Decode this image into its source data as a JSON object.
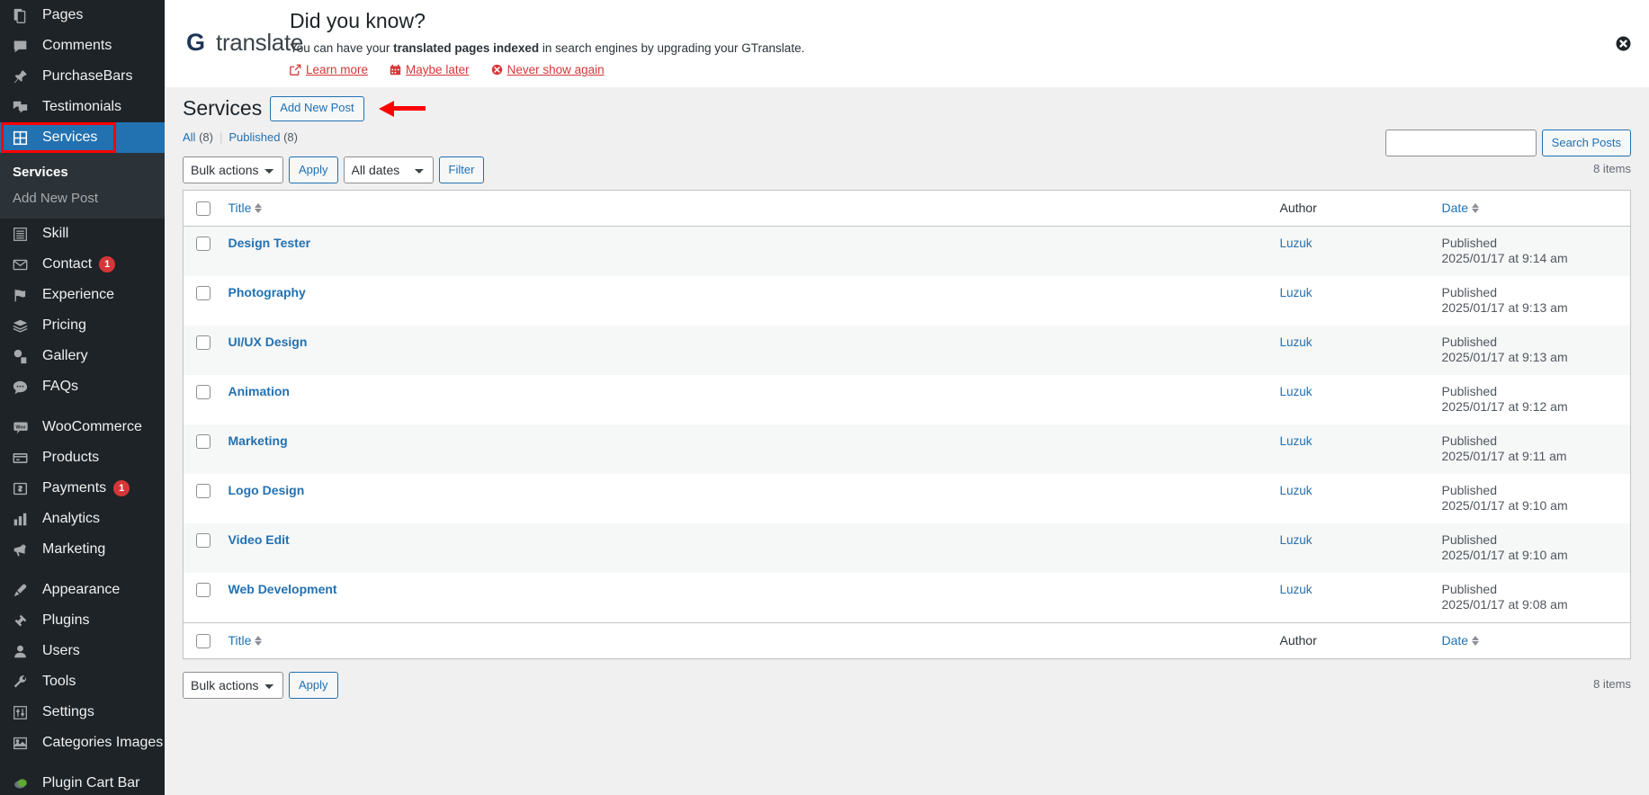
{
  "sidebar": {
    "items": [
      {
        "label": "Pages",
        "icon": "pages-icon",
        "badge": null,
        "current": false
      },
      {
        "label": "Comments",
        "icon": "comments-icon",
        "badge": null,
        "current": false
      },
      {
        "label": "PurchaseBars",
        "icon": "pin-icon",
        "badge": null,
        "current": false
      },
      {
        "label": "Testimonials",
        "icon": "testimonials-icon",
        "badge": null,
        "current": false
      },
      {
        "label": "Services",
        "icon": "grid-icon",
        "badge": null,
        "current": true
      },
      {
        "label": "Skill",
        "icon": "list-icon",
        "badge": null,
        "current": false
      },
      {
        "label": "Contact",
        "icon": "envelope-icon",
        "badge": "1",
        "current": false
      },
      {
        "label": "Experience",
        "icon": "flag-icon",
        "badge": null,
        "current": false
      },
      {
        "label": "Pricing",
        "icon": "stack-icon",
        "badge": null,
        "current": false
      },
      {
        "label": "Gallery",
        "icon": "gallery-icon",
        "badge": null,
        "current": false
      },
      {
        "label": "FAQs",
        "icon": "chat-icon",
        "badge": null,
        "current": false
      },
      {
        "label": "WooCommerce",
        "icon": "woo-icon",
        "badge": null,
        "current": false
      },
      {
        "label": "Products",
        "icon": "products-icon",
        "badge": null,
        "current": false
      },
      {
        "label": "Payments",
        "icon": "money-icon",
        "badge": "1",
        "current": false
      },
      {
        "label": "Analytics",
        "icon": "bar-chart-icon",
        "badge": null,
        "current": false
      },
      {
        "label": "Marketing",
        "icon": "megaphone-icon",
        "badge": null,
        "current": false
      },
      {
        "label": "Appearance",
        "icon": "brush-icon",
        "badge": null,
        "current": false
      },
      {
        "label": "Plugins",
        "icon": "plug-icon",
        "badge": null,
        "current": false
      },
      {
        "label": "Users",
        "icon": "user-icon",
        "badge": null,
        "current": false
      },
      {
        "label": "Tools",
        "icon": "wrench-icon",
        "badge": null,
        "current": false
      },
      {
        "label": "Settings",
        "icon": "sliders-icon",
        "badge": null,
        "current": false
      },
      {
        "label": "Categories Images",
        "icon": "image-icon",
        "badge": null,
        "current": false
      },
      {
        "label": "Plugin Cart Bar",
        "icon": "leaf-icon",
        "badge": null,
        "current": false
      }
    ],
    "submenu": {
      "active_label": "Services",
      "add_new_label": "Add New Post"
    }
  },
  "notice": {
    "logo_g": "G",
    "logo_text": "translate",
    "title": "Did you know?",
    "text_before": "You can have your ",
    "text_bold": "translated pages indexed",
    "text_after": " in search engines by upgrading your GTranslate.",
    "links": [
      {
        "label": "Learn more",
        "icon": "external-link-icon"
      },
      {
        "label": "Maybe later",
        "icon": "calendar-icon"
      },
      {
        "label": "Never show again",
        "icon": "cancel-circle-icon"
      }
    ],
    "dismiss_icon": "close-icon"
  },
  "page": {
    "title": "Services",
    "add_new_label": "Add New Post",
    "views": [
      {
        "label": "All",
        "count": "(8)"
      },
      {
        "label": "Published",
        "count": "(8)"
      }
    ],
    "divider": "|"
  },
  "tablenav": {
    "bulk_actions_label": "Bulk actions",
    "apply_label": "Apply",
    "all_dates_label": "All dates",
    "filter_label": "Filter",
    "items_count": "8 items",
    "bottom_items_count": "8 items"
  },
  "search": {
    "value": "",
    "placeholder": "",
    "button_label": "Search Posts"
  },
  "table": {
    "columns": {
      "title": "Title",
      "author": "Author",
      "date": "Date"
    },
    "rows": [
      {
        "title": "Design Tester",
        "author": "Luzuk",
        "status": "Published",
        "date": "2025/01/17 at 9:14 am"
      },
      {
        "title": "Photography",
        "author": "Luzuk",
        "status": "Published",
        "date": "2025/01/17 at 9:13 am"
      },
      {
        "title": "UI/UX Design",
        "author": "Luzuk",
        "status": "Published",
        "date": "2025/01/17 at 9:13 am"
      },
      {
        "title": "Animation",
        "author": "Luzuk",
        "status": "Published",
        "date": "2025/01/17 at 9:12 am"
      },
      {
        "title": "Marketing",
        "author": "Luzuk",
        "status": "Published",
        "date": "2025/01/17 at 9:11 am"
      },
      {
        "title": "Logo Design",
        "author": "Luzuk",
        "status": "Published",
        "date": "2025/01/17 at 9:10 am"
      },
      {
        "title": "Video Edit",
        "author": "Luzuk",
        "status": "Published",
        "date": "2025/01/17 at 9:10 am"
      },
      {
        "title": "Web Development",
        "author": "Luzuk",
        "status": "Published",
        "date": "2025/01/17 at 9:08 am"
      }
    ]
  },
  "colors": {
    "accent": "#2271b1",
    "sidebar_bg": "#1d2327",
    "highlight_red": "#ff0000",
    "link_red": "#d63638"
  }
}
